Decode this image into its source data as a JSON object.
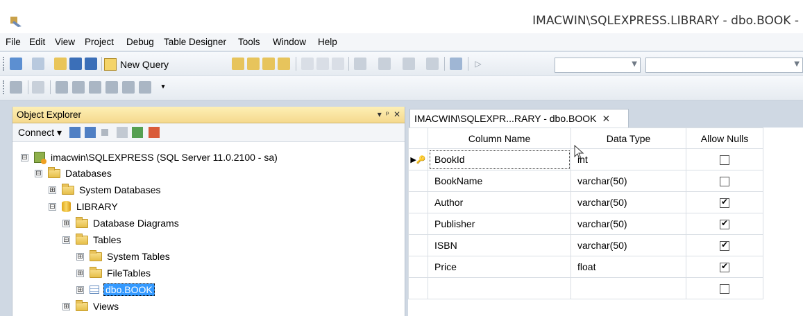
{
  "window": {
    "title": "IMACWIN\\SQLEXPRESS.LIBRARY - dbo.BOOK -",
    "app_icon": "ssms-icon"
  },
  "menu": [
    "File",
    "Edit",
    "View",
    "Project",
    "Debug",
    "Table Designer",
    "Tools",
    "Window",
    "Help"
  ],
  "toolbar": {
    "new_query_label": "New Query"
  },
  "object_explorer": {
    "title": "Object Explorer",
    "controls": [
      "▾",
      "ᵖ",
      "✕"
    ],
    "connect_label": "Connect ▾",
    "tree": [
      {
        "label": "imacwin\\SQLEXPRESS (SQL Server 11.0.2100 - sa)",
        "expander": "⊟",
        "icon": "server-icon"
      },
      {
        "label": "Databases",
        "expander": "⊟",
        "icon": "folder-icon"
      },
      {
        "label": "System Databases",
        "expander": "⊞",
        "icon": "folder-icon"
      },
      {
        "label": "LIBRARY",
        "expander": "⊟",
        "icon": "database-icon"
      },
      {
        "label": "Database Diagrams",
        "expander": "⊞",
        "icon": "folder-icon"
      },
      {
        "label": "Tables",
        "expander": "⊟",
        "icon": "folder-icon"
      },
      {
        "label": "System Tables",
        "expander": "⊞",
        "icon": "folder-icon"
      },
      {
        "label": "FileTables",
        "expander": "⊞",
        "icon": "folder-icon"
      },
      {
        "label": "dbo.BOOK",
        "expander": "⊞",
        "icon": "table-icon",
        "selected": true
      },
      {
        "label": "Views",
        "expander": "⊞",
        "icon": "folder-icon"
      }
    ]
  },
  "editor": {
    "tab_label": "IMACWIN\\SQLEXPR...RARY - dbo.BOOK",
    "tab_close": "✕",
    "headers": {
      "column_name": "Column Name",
      "data_type": "Data Type",
      "allow_nulls": "Allow Nulls"
    },
    "rows": [
      {
        "indicator": "▶🔑",
        "name": "BookId",
        "type": "int",
        "allow_nulls": false
      },
      {
        "indicator": "",
        "name": "BookName",
        "type": "varchar(50)",
        "allow_nulls": false
      },
      {
        "indicator": "",
        "name": "Author",
        "type": "varchar(50)",
        "allow_nulls": true
      },
      {
        "indicator": "",
        "name": "Publisher",
        "type": "varchar(50)",
        "allow_nulls": true
      },
      {
        "indicator": "",
        "name": "ISBN",
        "type": "varchar(50)",
        "allow_nulls": true
      },
      {
        "indicator": "",
        "name": "Price",
        "type": "float",
        "allow_nulls": true
      },
      {
        "indicator": "",
        "name": "",
        "type": "",
        "allow_nulls": false
      }
    ]
  }
}
